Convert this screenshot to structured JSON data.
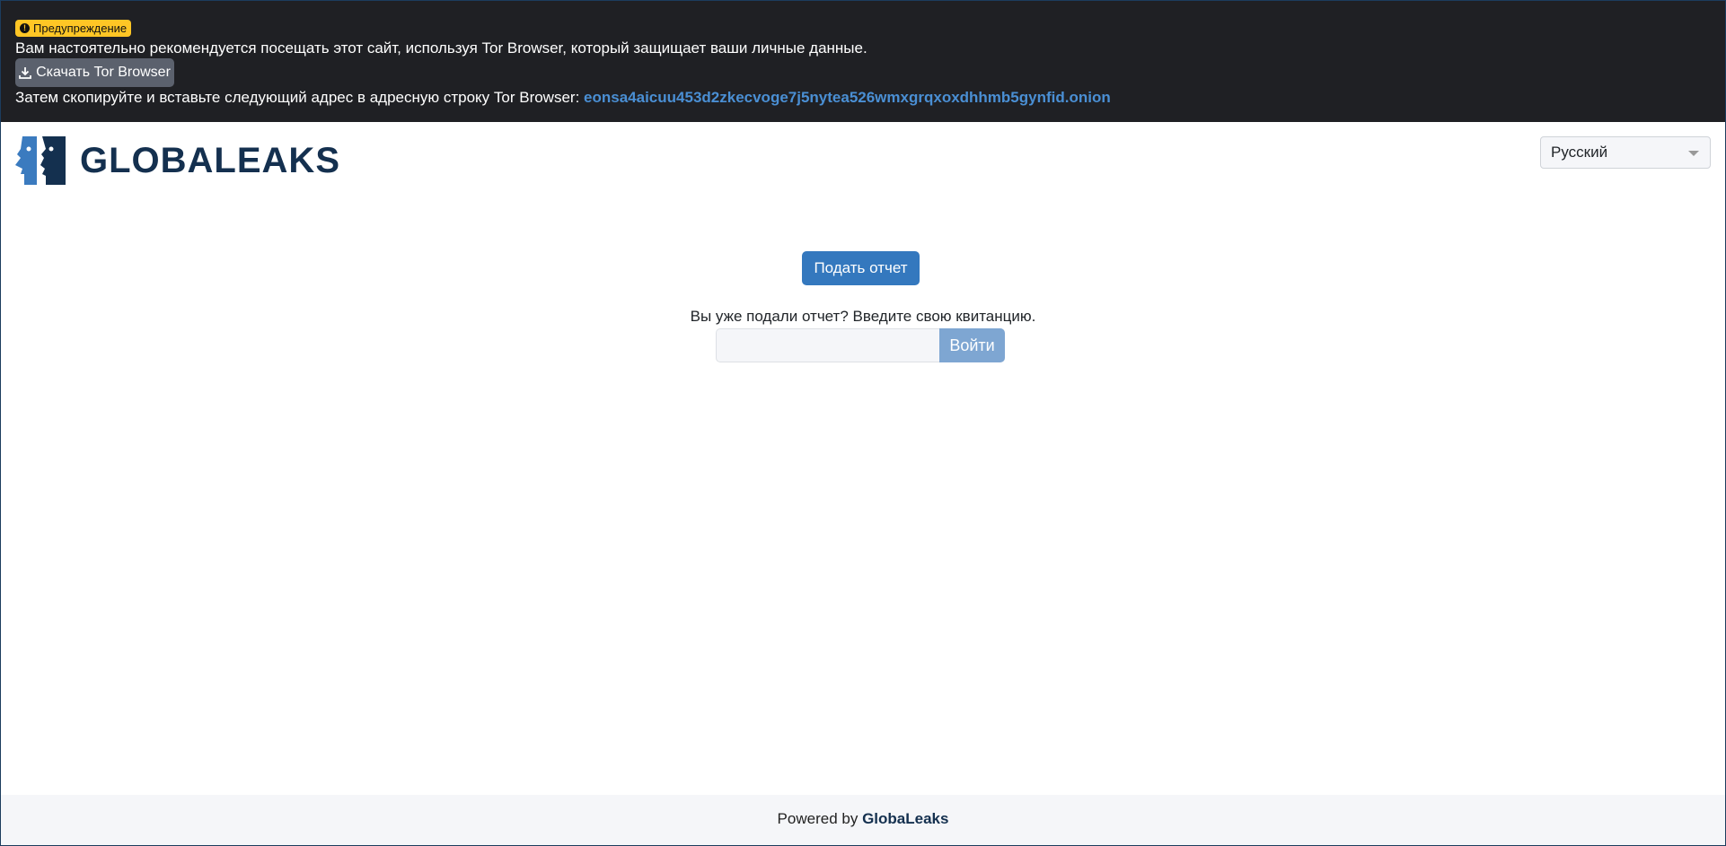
{
  "banner": {
    "badge": "Предупреждение",
    "message": "Вам настоятельно рекомендуется посещать этот сайт, используя Tor Browser, который защищает ваши личные данные.",
    "download_label": "Скачать Tor Browser",
    "instruction": "Затем скопируйте и вставьте следующий адрес в адресную строку Tor Browser:",
    "onion": "eonsa4aicuu453d2zkecvoge7j5nytea526wmxgrqxoxdhhmb5gynfid.onion"
  },
  "header": {
    "logo_text": "GLOBALEAKS",
    "language": "Русский"
  },
  "main": {
    "submit_label": "Подать отчет",
    "receipt_prompt": "Вы уже подали отчет? Введите свою квитанцию.",
    "receipt_value": "",
    "login_label": "Войти"
  },
  "footer": {
    "prefix": "Powered by",
    "brand": "GlobaLeaks"
  }
}
